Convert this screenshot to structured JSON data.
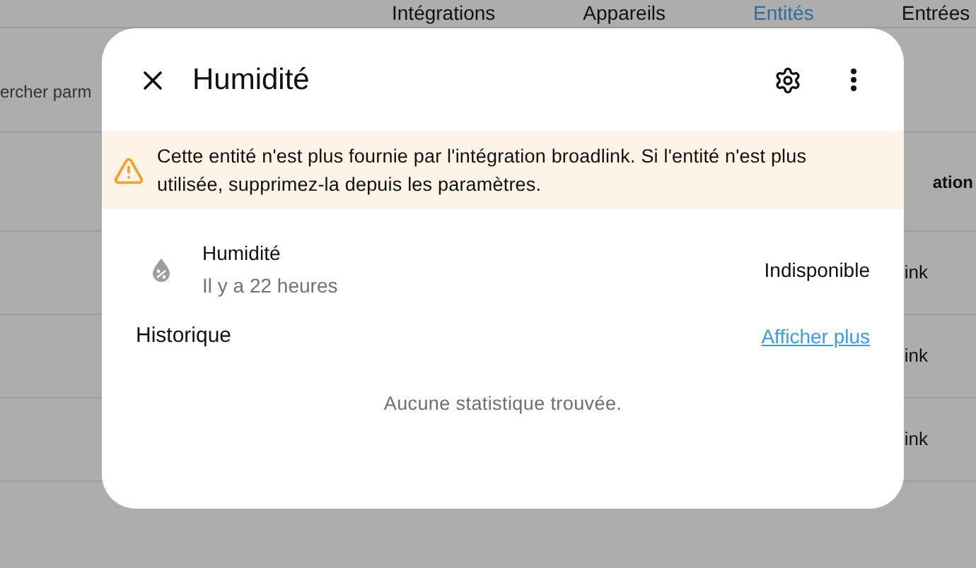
{
  "background": {
    "tabs": [
      {
        "label": "Intégrations",
        "selected": false
      },
      {
        "label": "Appareils",
        "selected": false
      },
      {
        "label": "Entités",
        "selected": true
      },
      {
        "label": "Entrées",
        "selected": false
      }
    ],
    "search": {
      "placeholder": "ercher parm"
    },
    "table": {
      "header": "ation",
      "rows": [
        {
          "column_1": "ink"
        },
        {
          "column_1": "ink"
        },
        {
          "column_1": "ink"
        }
      ]
    }
  },
  "dialog": {
    "title": "Humidité",
    "warning": "Cette entité n'est plus fournie par l'intégration broadlink. Si l'entité n'est plus utilisée, supprimez-la depuis les paramètres.",
    "entity": {
      "name": "Humidité",
      "time": "Il y a 22 heures",
      "state": "Indisponible"
    },
    "history": {
      "title": "Historique",
      "link": "Afficher plus",
      "empty": "Aucune statistique trouvée."
    }
  }
}
